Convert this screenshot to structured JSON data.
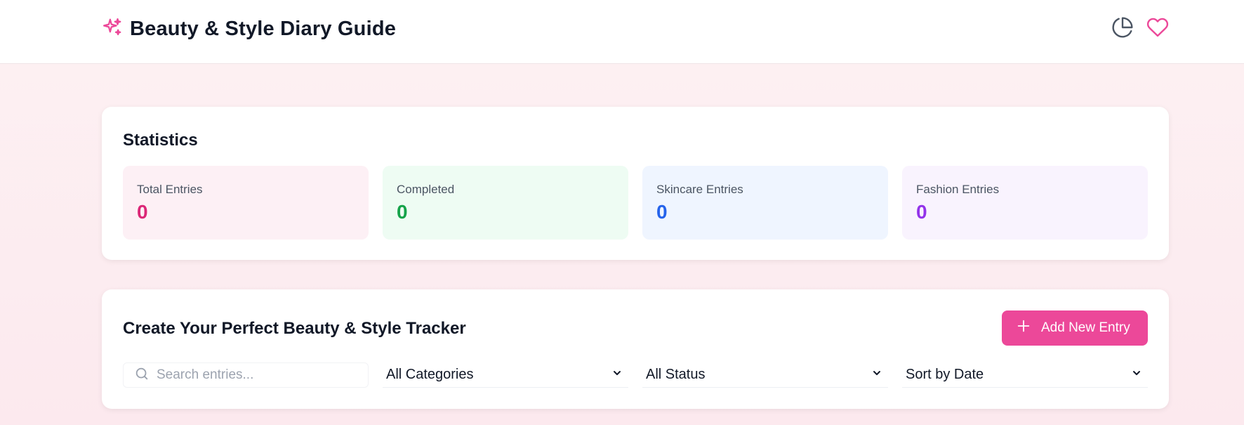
{
  "header": {
    "title": "Beauty & Style Diary Guide",
    "brand_icon": "sparkles-icon",
    "actions": [
      {
        "name": "statistics",
        "icon": "pie-chart-icon"
      },
      {
        "name": "favorites",
        "icon": "heart-icon"
      }
    ]
  },
  "colors": {
    "accent": "#ec4899",
    "pink": "#db2777",
    "green": "#16a34a",
    "blue": "#2563eb",
    "purple": "#9333ea"
  },
  "statistics": {
    "title": "Statistics",
    "items": [
      {
        "label": "Total Entries",
        "value": "0"
      },
      {
        "label": "Completed",
        "value": "0"
      },
      {
        "label": "Skincare Entries",
        "value": "0"
      },
      {
        "label": "Fashion Entries",
        "value": "0"
      }
    ]
  },
  "tracker": {
    "title": "Create Your Perfect Beauty & Style Tracker",
    "add_button_label": "Add New Entry",
    "search": {
      "placeholder": "Search entries...",
      "value": ""
    },
    "filters": {
      "category": "All Categories",
      "status": "All Status",
      "sort": "Sort by Date"
    }
  }
}
